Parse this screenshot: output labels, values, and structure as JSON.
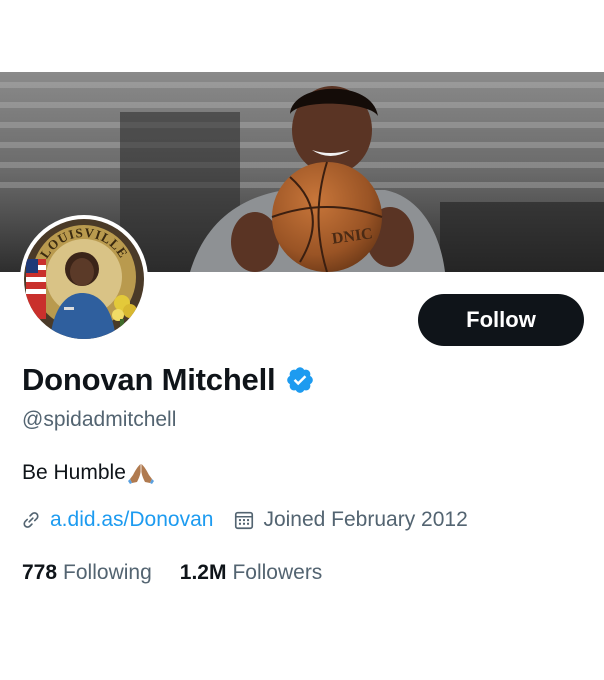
{
  "profile": {
    "display_name": "Donovan Mitchell",
    "handle": "@spidadmitchell",
    "bio": "Be Humble",
    "bio_emoji": "folded-hands-emoji",
    "link": "a.did.as/Donovan",
    "joined": "Joined February 2012",
    "follow_label": "Follow",
    "avatar_seal_text": "LOUISVILLE",
    "banner_ball_text": "DNIC"
  },
  "stats": {
    "following_count": "778",
    "following_label": "Following",
    "followers_count": "1.2M",
    "followers_label": "Followers"
  },
  "icons": {
    "verified": "verified-badge-icon",
    "link": "link-icon",
    "calendar": "calendar-icon"
  },
  "colors": {
    "accent": "#1d9bf0",
    "text_primary": "#0f1419",
    "text_secondary": "#536471",
    "button_bg": "#0f1419"
  }
}
